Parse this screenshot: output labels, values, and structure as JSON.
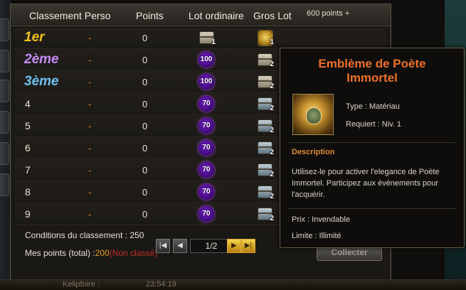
{
  "header": {
    "col_rank": "Classement Perso",
    "col_points": "Points",
    "col_lot": "Lot ordinaire",
    "col_gros": "Gros Lot",
    "col_extra": "600 points +"
  },
  "rows": [
    {
      "rank": "1er",
      "perso": "-",
      "points": "0",
      "lot": {
        "icon": "chest-icon",
        "count": "1"
      },
      "gros": {
        "icon": "golden-emblem-icon",
        "count": "1"
      }
    },
    {
      "rank": "2ème",
      "perso": "-",
      "points": "0",
      "lot": {
        "icon": "purple-orb-icon",
        "count": "100"
      },
      "gros": {
        "icon": "chest-icon",
        "count": "2"
      }
    },
    {
      "rank": "3ème",
      "perso": "-",
      "points": "0",
      "lot": {
        "icon": "purple-orb-icon",
        "count": "100"
      },
      "gros": {
        "icon": "chest-icon",
        "count": "2"
      }
    },
    {
      "rank": "4",
      "perso": "-",
      "points": "0",
      "lot": {
        "icon": "purple-orb-icon",
        "count": "70"
      },
      "gros": {
        "icon": "blue-chest-icon",
        "count": "2"
      }
    },
    {
      "rank": "5",
      "perso": "-",
      "points": "0",
      "lot": {
        "icon": "purple-orb-icon",
        "count": "70"
      },
      "gros": {
        "icon": "blue-chest-icon",
        "count": "2"
      }
    },
    {
      "rank": "6",
      "perso": "-",
      "points": "0",
      "lot": {
        "icon": "purple-orb-icon",
        "count": "70"
      },
      "gros": {
        "icon": "blue-chest-icon",
        "count": "2"
      }
    },
    {
      "rank": "7",
      "perso": "-",
      "points": "0",
      "lot": {
        "icon": "purple-orb-icon",
        "count": "70"
      },
      "gros": {
        "icon": "blue-chest-icon",
        "count": "2"
      }
    },
    {
      "rank": "8",
      "perso": "-",
      "points": "0",
      "lot": {
        "icon": "purple-orb-icon",
        "count": "70"
      },
      "gros": {
        "icon": "blue-chest-icon",
        "count": "2"
      }
    },
    {
      "rank": "9",
      "perso": "-",
      "points": "0",
      "lot": {
        "icon": "purple-orb-icon",
        "count": "70"
      },
      "gros": {
        "icon": "blue-chest-icon",
        "count": "2"
      }
    }
  ],
  "footer": {
    "conditions": "Conditions du classement : 250",
    "my_points_label": "Mes points (total) :",
    "my_points_value": "200",
    "my_points_status": "(Non classé)"
  },
  "pager": {
    "page": "1/2",
    "first_icon": "first-page-icon",
    "prev_icon": "prev-page-icon",
    "next_icon": "next-page-icon",
    "last_icon": "last-page-icon"
  },
  "collect_label": "Collecter",
  "tooltip": {
    "title_line1": "Emblème de Poète",
    "title_line2": "Immortel",
    "type": "Type : Matériau",
    "requires": "Requiert : Niv. 1",
    "desc_heading": "Description",
    "desc_text": "Utilisez-le pour activer l'elegance de Poète Immortel. Participez aux événements pour l'acquérir.",
    "price": "Prix : Invendable",
    "limit": "Limite : Illimité"
  },
  "bottom_bar": {
    "text1": "Kelipfoire :",
    "text2": "23:54:19"
  }
}
